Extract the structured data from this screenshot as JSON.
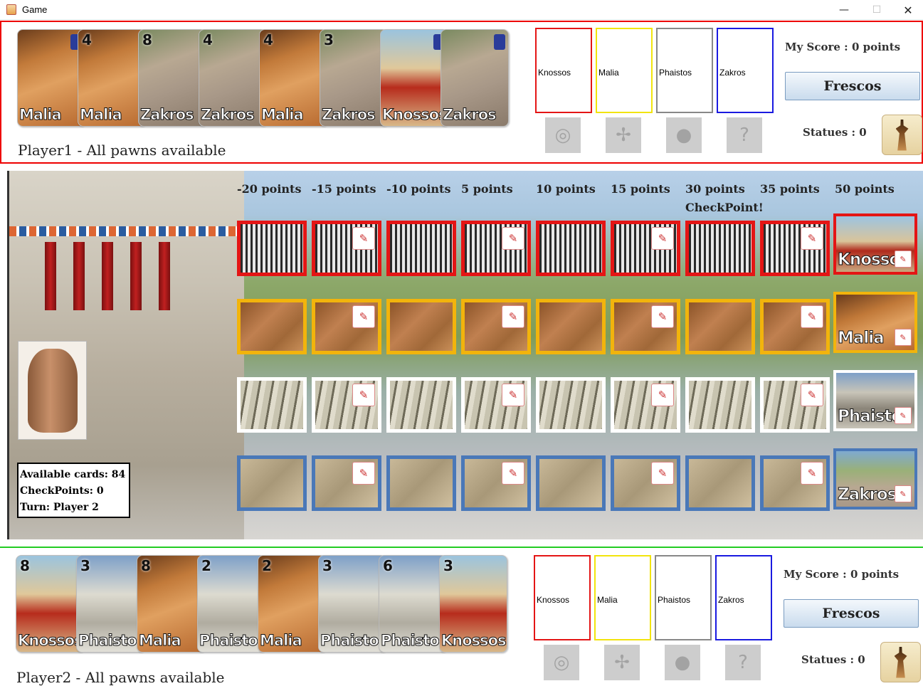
{
  "window": {
    "title": "Game",
    "minimize": "—",
    "maximize": "☐",
    "close": "✕"
  },
  "players": [
    {
      "label": "Player1 - All pawns available",
      "hand": [
        {
          "name": "Malia",
          "number": ""
        },
        {
          "name": "Malia",
          "number": "4"
        },
        {
          "name": "Zakros",
          "number": "8"
        },
        {
          "name": "Zakros",
          "number": "4"
        },
        {
          "name": "Malia",
          "number": "4"
        },
        {
          "name": "Zakros",
          "number": "3"
        },
        {
          "name": "Knossos",
          "number": ""
        },
        {
          "name": "Zakros",
          "number": ""
        }
      ],
      "palaces": [
        "Knossos",
        "Malia",
        "Phaistos",
        "Zakros"
      ],
      "score": "My Score : 0 points",
      "frescos": "Frescos",
      "statues": "Statues : 0"
    },
    {
      "label": "Player2 - All pawns available",
      "hand": [
        {
          "name": "Knossos",
          "number": "8"
        },
        {
          "name": "Phaistos",
          "number": "3"
        },
        {
          "name": "Malia",
          "number": "8"
        },
        {
          "name": "Phaistos",
          "number": "2"
        },
        {
          "name": "Malia",
          "number": "2"
        },
        {
          "name": "Phaistos",
          "number": "3"
        },
        {
          "name": "Phaistos",
          "number": "6"
        },
        {
          "name": "Knossos",
          "number": "3"
        }
      ],
      "palaces": [
        "Knossos",
        "Malia",
        "Phaistos",
        "Zakros"
      ],
      "score": "My Score : 0 points",
      "frescos": "Frescos",
      "statues": "Statues : 0"
    }
  ],
  "board": {
    "points": [
      "-20 points",
      "-15 points",
      "-10 points",
      "5 points",
      "10 points",
      "15 points",
      "30 points",
      "35 points",
      "50 points"
    ],
    "checkpoint": "CheckPoint!",
    "rows": [
      {
        "color": "red",
        "palace": "Knossos",
        "stamps": [
          false,
          true,
          false,
          true,
          false,
          true,
          false,
          true
        ]
      },
      {
        "color": "yellow",
        "palace": "Malia",
        "stamps": [
          false,
          true,
          false,
          true,
          false,
          true,
          false,
          true
        ]
      },
      {
        "color": "white",
        "palace": "Phaistos",
        "stamps": [
          false,
          true,
          false,
          true,
          false,
          true,
          false,
          true
        ]
      },
      {
        "color": "blue",
        "palace": "Zakros",
        "stamps": [
          false,
          true,
          false,
          true,
          false,
          true,
          false,
          true
        ]
      }
    ],
    "info": {
      "available_cards": "Available cards: 84",
      "checkpoints": "CheckPoints: 0",
      "turn": "Turn: Player 2"
    }
  },
  "colors": {
    "red": "#e41515",
    "yellow": "#f2b40c",
    "white": "#ffffff",
    "blue": "#4a78b8",
    "player1_border": "#e00000",
    "player2_border": "#22cc22"
  },
  "icons": {
    "statue_slots": [
      "disc-icon",
      "bird-icon",
      "coin-icon",
      "amphora-question-icon"
    ],
    "goddess": "snake-goddess-icon",
    "fresco_stamp": "fresco-stamp-icon"
  }
}
